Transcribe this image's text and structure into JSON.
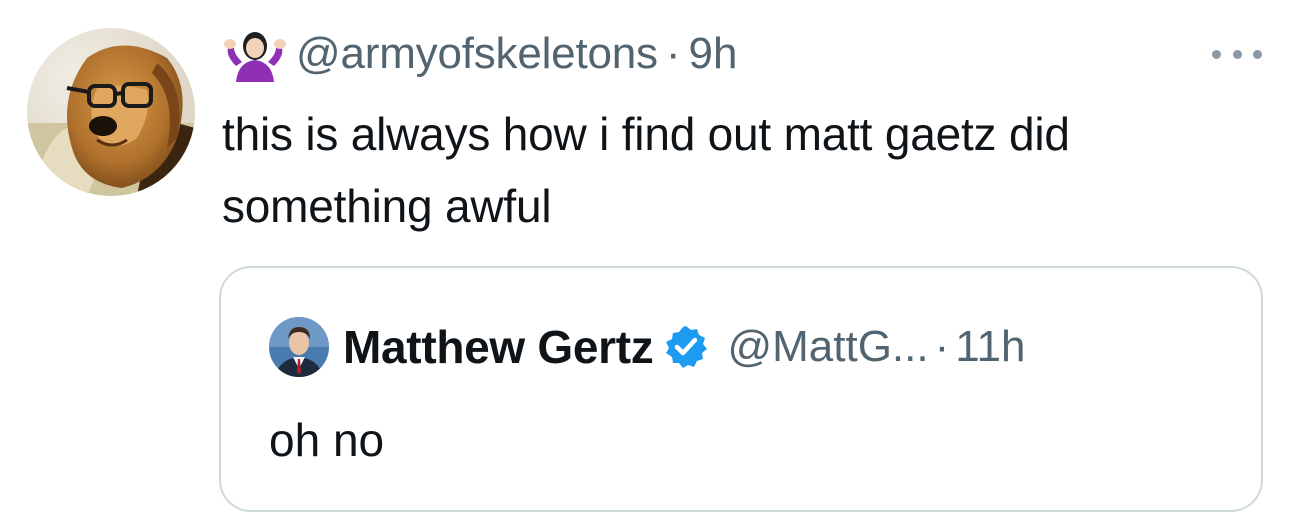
{
  "tweet": {
    "author_emoji_icon": "person-shrugging-emoji-icon",
    "handle": "@armyofskeletons",
    "separator": "·",
    "time": "9h",
    "text": "this is always how i find out matt gaetz did something awful",
    "more_icon": "more-options-icon"
  },
  "quoted_tweet": {
    "display_name": "Matthew Gertz",
    "verified_icon": "verified-badge-icon",
    "handle": "@MattG...",
    "separator": "·",
    "time": "11h",
    "text": "oh no"
  },
  "colors": {
    "text_primary": "#0f1419",
    "text_secondary": "#536471",
    "border": "#cfd9de",
    "verified_blue": "#1d9bf0"
  }
}
